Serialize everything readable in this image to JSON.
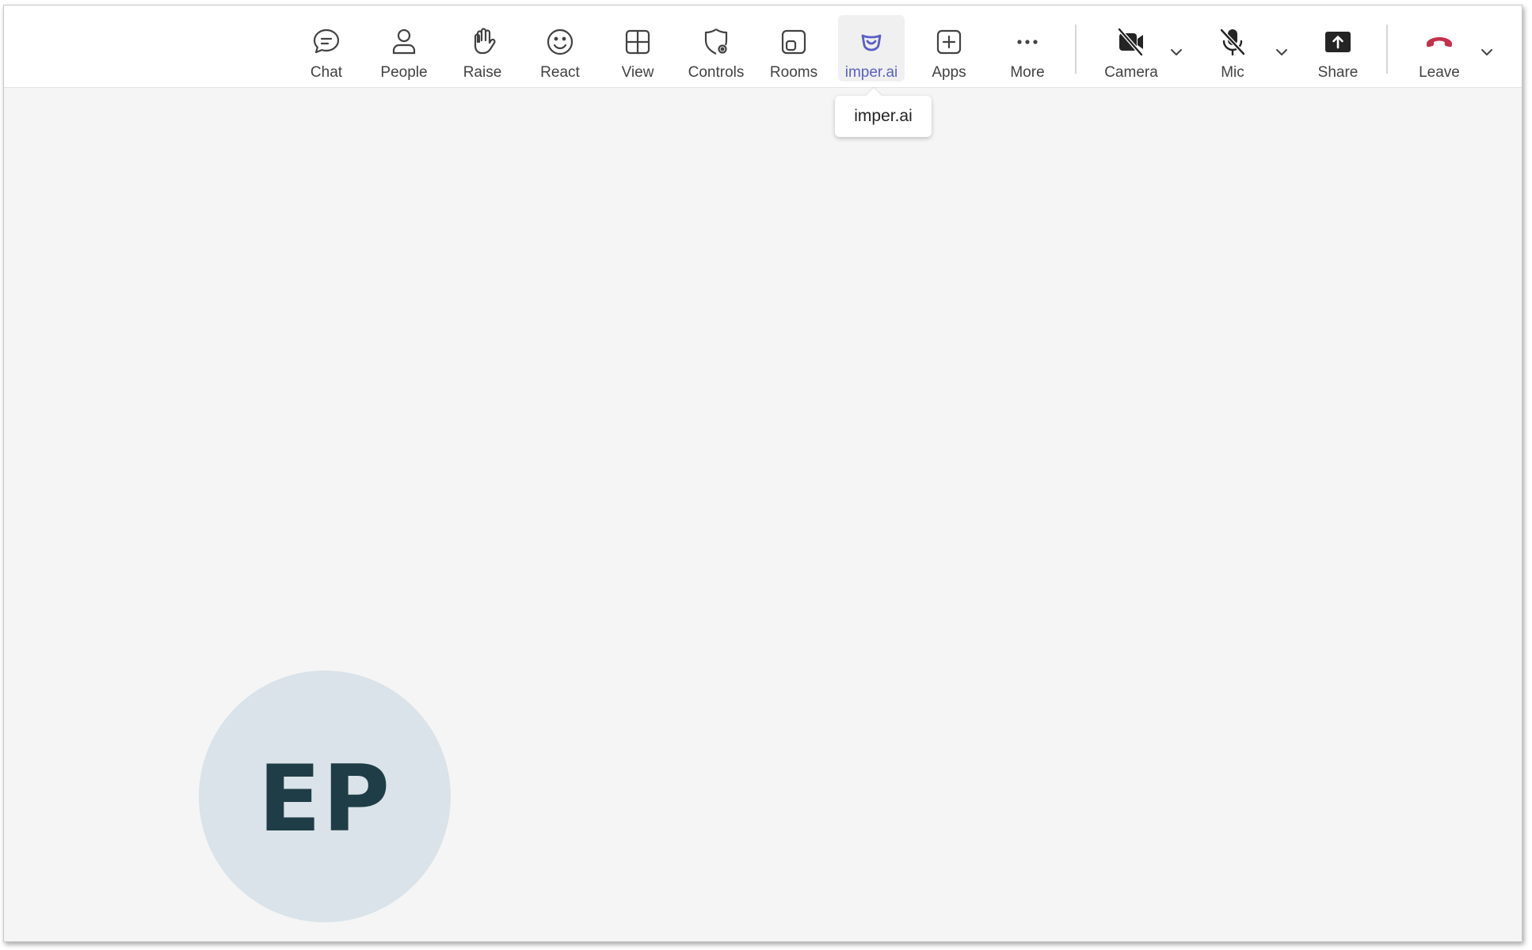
{
  "toolbar": {
    "chat": {
      "label": "Chat",
      "icon": "chat-icon"
    },
    "people": {
      "label": "People",
      "icon": "person-icon"
    },
    "raise": {
      "label": "Raise",
      "icon": "hand-icon"
    },
    "react": {
      "label": "React",
      "icon": "smiley-icon"
    },
    "view": {
      "label": "View",
      "icon": "grid-icon"
    },
    "controls": {
      "label": "Controls",
      "icon": "shield-gear-icon"
    },
    "rooms": {
      "label": "Rooms",
      "icon": "rooms-icon"
    },
    "imper": {
      "label": "imper.ai",
      "icon": "imper-ai-icon",
      "active": true
    },
    "apps": {
      "label": "Apps",
      "icon": "plus-square-icon"
    },
    "more": {
      "label": "More",
      "icon": "ellipsis-icon"
    },
    "camera": {
      "label": "Camera",
      "icon": "camera-off-icon",
      "state": "off"
    },
    "mic": {
      "label": "Mic",
      "icon": "mic-off-icon",
      "state": "muted"
    },
    "share": {
      "label": "Share",
      "icon": "share-icon"
    },
    "leave": {
      "label": "Leave",
      "icon": "phone-hangup-icon"
    }
  },
  "tooltip": {
    "text": "imper.ai"
  },
  "participant": {
    "initials": "EP"
  },
  "colors": {
    "accent": "#5b5fc7",
    "leave": "#c4314b",
    "stage_bg": "#f5f5f5",
    "avatar_bg": "#d9e3e9",
    "avatar_text": "#1f3d46"
  }
}
